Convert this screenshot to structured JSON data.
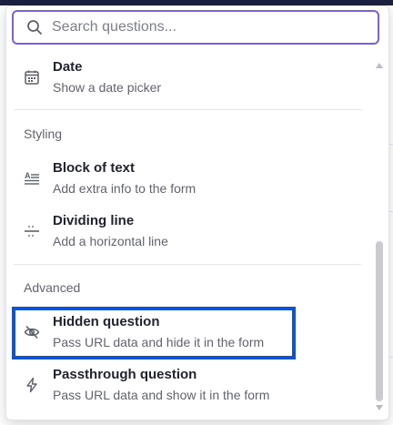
{
  "search": {
    "placeholder": "Search questions..."
  },
  "items": {
    "date": {
      "title": "Date",
      "desc": "Show a date picker",
      "icon": "calendar-icon"
    },
    "block_of_text": {
      "title": "Block of text",
      "desc": "Add extra info to the form",
      "icon": "text-block-icon"
    },
    "dividing_line": {
      "title": "Dividing line",
      "desc": "Add a horizontal line",
      "icon": "divider-icon"
    },
    "hidden_question": {
      "title": "Hidden question",
      "desc": "Pass URL data and hide it in the form",
      "icon": "eye-off-icon"
    },
    "passthrough_question": {
      "title": "Passthrough question",
      "desc": "Pass URL data and show it in the form",
      "icon": "lightning-icon"
    }
  },
  "sections": {
    "styling": "Styling",
    "advanced": "Advanced"
  },
  "colors": {
    "focus": "#7c5fe6",
    "highlight": "#0f52d6",
    "topbar": "#1d2140"
  }
}
